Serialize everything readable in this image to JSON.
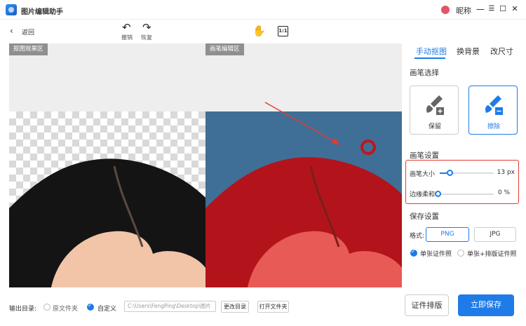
{
  "app": {
    "title": "图片编辑助手",
    "nickname": "昵称"
  },
  "window": {
    "min": "—",
    "menu": "☰",
    "max": "☐",
    "close": "✕"
  },
  "toolbar": {
    "back": "返回",
    "undo": "撤销",
    "redo": "恢复",
    "undo_icon": "↶",
    "redo_icon": "↷",
    "hand_icon": "✋",
    "ratio_icon": "1:1"
  },
  "canvas": {
    "left_title": "抠图效果区",
    "right_title": "画笔编辑区"
  },
  "tabs": [
    {
      "label": "手动抠图"
    },
    {
      "label": "换背景"
    },
    {
      "label": "改尺寸"
    }
  ],
  "brush": {
    "title": "画笔选择",
    "keep": "保留",
    "erase": "擦除"
  },
  "brush_settings": {
    "title": "画笔设置",
    "size_label": "画笔大小",
    "size_value": 13,
    "size_display": "13 px",
    "soft_label": "边缘柔和",
    "soft_value": 0,
    "soft_display": "0 %"
  },
  "save": {
    "title": "保存设置",
    "format_label": "格式:",
    "formats": [
      "PNG",
      "JPG"
    ],
    "selected_format": "PNG",
    "single": "单张证件照",
    "multi": "单张+排版证件照"
  },
  "output": {
    "label": "输出目录:",
    "original": "原文件夹",
    "custom": "自定义",
    "path": "C:\\Users\\FengPing\\Desktop\\图片",
    "change": "更改目录",
    "open": "打开文件夹"
  },
  "actions": {
    "layout": "证件排版",
    "save": "立即保存"
  },
  "colors": {
    "accent": "#1e7be8",
    "hair_overlay": "#b3141c",
    "annotation": "#e53935"
  }
}
